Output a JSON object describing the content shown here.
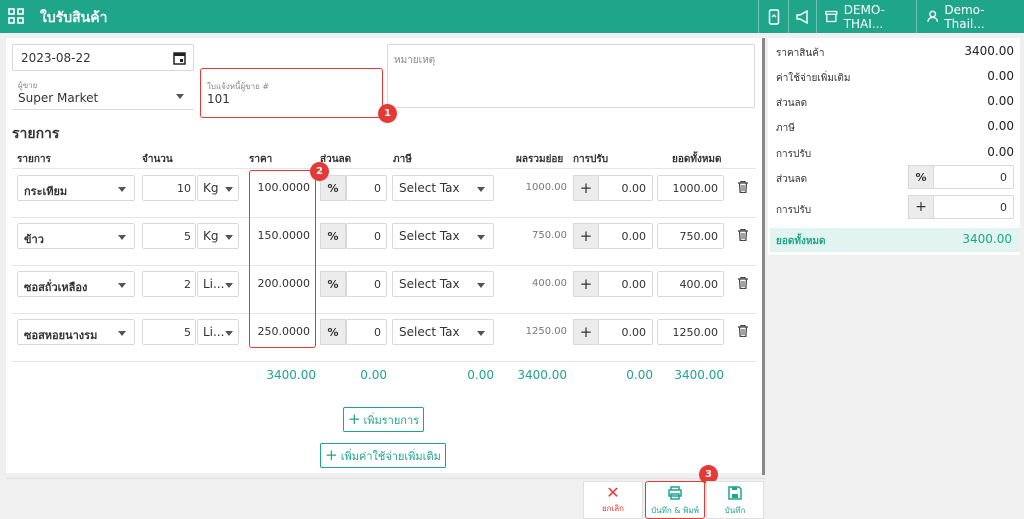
{
  "header": {
    "title": "ใบรับสินค้า",
    "location": "DEMO-THAI...",
    "user": "Demo- Thail..."
  },
  "form": {
    "date": "2023-08-22",
    "note_placeholder": "หมายเหตุ",
    "vendor_label": "ผู้ขาย",
    "vendor_value": "Super Market",
    "invoice_label": "ใบแจ้งหนี้ผู้ขาย #",
    "invoice_value": "101"
  },
  "section_title": "รายการ",
  "columns": [
    "รายการ",
    "จำนวน",
    "ราคา",
    "ส่วนลด",
    "ภาษี",
    "ผลรวมย่อย",
    "การปรับ",
    "ยอดทั้งหมด"
  ],
  "rows": [
    {
      "item": "กระเทียม",
      "qty": "10",
      "unit": "Kg",
      "price": "100.0000",
      "disc_sym": "%",
      "disc": "0",
      "tax": "Select Tax",
      "subtotal": "1000.00",
      "adj_sym": "+",
      "adj": "0.00",
      "total": "1000.00"
    },
    {
      "item": "ข้าว",
      "qty": "5",
      "unit": "Kg",
      "price": "150.0000",
      "disc_sym": "%",
      "disc": "0",
      "tax": "Select Tax",
      "subtotal": "750.00",
      "adj_sym": "+",
      "adj": "0.00",
      "total": "750.00"
    },
    {
      "item": "ซอสถั่วเหลือง",
      "qty": "2",
      "unit": "Li...",
      "price": "200.0000",
      "disc_sym": "%",
      "disc": "0",
      "tax": "Select Tax",
      "subtotal": "400.00",
      "adj_sym": "+",
      "adj": "0.00",
      "total": "400.00"
    },
    {
      "item": "ซอสหอยนางรม",
      "qty": "5",
      "unit": "Li...",
      "price": "250.0000",
      "disc_sym": "%",
      "disc": "0",
      "tax": "Select Tax",
      "subtotal": "1250.00",
      "adj_sym": "+",
      "adj": "0.00",
      "total": "1250.00"
    }
  ],
  "totals": {
    "price": "3400.00",
    "discount": "0.00",
    "tax": "0.00",
    "subtotal": "3400.00",
    "adjust": "0.00",
    "total": "3400.00"
  },
  "buttons": {
    "add_item": "เพิ่มรายการ",
    "add_expense": "เพิ่มค่าใช้จ่ายเพิ่มเติม",
    "cancel": "ยกเลิก",
    "save_print": "บันทึก & พิมพ์",
    "save": "บันทึก"
  },
  "summary": {
    "product_price_label": "ราคาสินค้า",
    "product_price": "3400.00",
    "extra_label": "ค่าใช้จ่ายเพิ่มเติม",
    "extra": "0.00",
    "discount_label": "ส่วนลด",
    "discount": "0.00",
    "tax_label": "ภาษี",
    "tax": "0.00",
    "adjust_label": "การปรับ",
    "adjust": "0.00",
    "discount_input_label": "ส่วนลด",
    "discount_sym": "%",
    "discount_input": "0",
    "adjust_input_label": "การปรับ",
    "adjust_sym": "+",
    "adjust_input": "0",
    "total_label": "ยอดทั้งหมด",
    "total": "3400.00"
  },
  "annotations": {
    "b1": "1",
    "b2": "2",
    "b3": "3"
  },
  "colors": {
    "brand": "#1fa58a",
    "annotation": "#e53935"
  }
}
